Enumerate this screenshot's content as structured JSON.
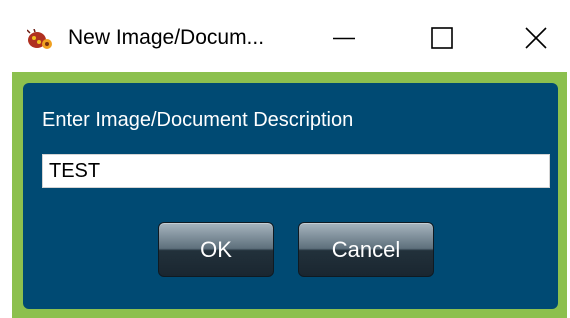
{
  "window": {
    "title": "New Image/Docum...",
    "app_icon": "bug-icon",
    "controls": {
      "minimize": "minimize-icon",
      "maximize": "maximize-icon",
      "close": "close-icon"
    }
  },
  "dialog": {
    "prompt_label": "Enter Image/Document Description",
    "description_value": "TEST",
    "ok_label": "OK",
    "cancel_label": "Cancel"
  },
  "colors": {
    "frame_green": "#8cc04e",
    "panel_blue": "#004a73",
    "button_dark": "#22313b"
  }
}
